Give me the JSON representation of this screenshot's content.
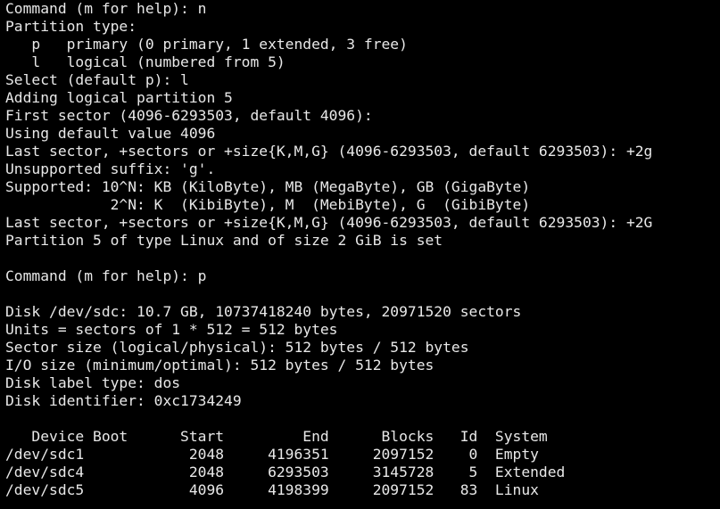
{
  "terminal": {
    "lines": [
      "Command (m for help): n",
      "Partition type:",
      "   p   primary (0 primary, 1 extended, 3 free)",
      "   l   logical (numbered from 5)",
      "Select (default p): l",
      "Adding logical partition 5",
      "First sector (4096-6293503, default 4096):",
      "Using default value 4096",
      "Last sector, +sectors or +size{K,M,G} (4096-6293503, default 6293503): +2g",
      "Unsupported suffix: 'g'.",
      "Supported: 10^N: KB (KiloByte), MB (MegaByte), GB (GigaByte)",
      "            2^N: K  (KibiByte), M  (MebiByte), G  (GibiByte)",
      "Last sector, +sectors or +size{K,M,G} (4096-6293503, default 6293503): +2G",
      "Partition 5 of type Linux and of size 2 GiB is set",
      "",
      "Command (m for help): p",
      "",
      "Disk /dev/sdc: 10.7 GB, 10737418240 bytes, 20971520 sectors",
      "Units = sectors of 1 * 512 = 512 bytes",
      "Sector size (logical/physical): 512 bytes / 512 bytes",
      "I/O size (minimum/optimal): 512 bytes / 512 bytes",
      "Disk label type: dos",
      "Disk identifier: 0xc1734249",
      "",
      "   Device Boot      Start         End      Blocks   Id  System",
      "/dev/sdc1            2048     4196351     2097152    0  Empty",
      "/dev/sdc4            2048     6293503     3145728    5  Extended",
      "/dev/sdc5            4096     4198399     2097152   83  Linux"
    ]
  }
}
